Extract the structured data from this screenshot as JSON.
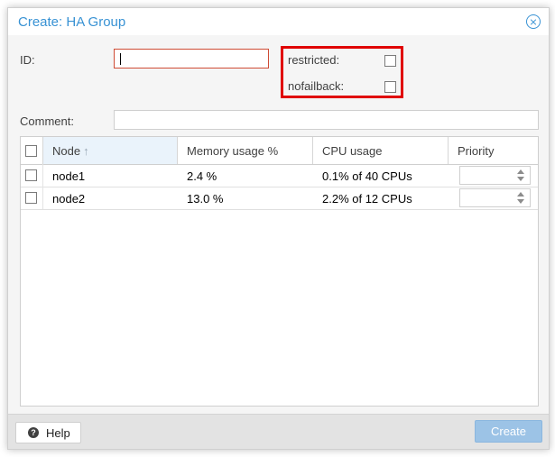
{
  "dialog": {
    "title": "Create: HA Group",
    "icons": {
      "close": "close-circle-icon",
      "help": "question-circle-icon",
      "sort": "sort-ascending-icon"
    },
    "accent_color": "#3892d4"
  },
  "form": {
    "id_label": "ID:",
    "id_value": "",
    "restricted_label": "restricted:",
    "restricted_checked": false,
    "nofailback_label": "nofailback:",
    "nofailback_checked": false,
    "comment_label": "Comment:",
    "comment_value": ""
  },
  "grid": {
    "columns": [
      {
        "label": "Node",
        "sort_indicator": "↑"
      },
      {
        "label": "Memory usage %"
      },
      {
        "label": "CPU usage"
      },
      {
        "label": "Priority"
      }
    ],
    "rows": [
      {
        "node": "node1",
        "memory": "2.4 %",
        "cpu": "0.1% of 40 CPUs",
        "priority": "",
        "selected": false
      },
      {
        "node": "node2",
        "memory": "13.0 %",
        "cpu": "2.2% of 12 CPUs",
        "priority": "",
        "selected": false
      }
    ]
  },
  "footer": {
    "help_label": "Help",
    "create_label": "Create"
  }
}
